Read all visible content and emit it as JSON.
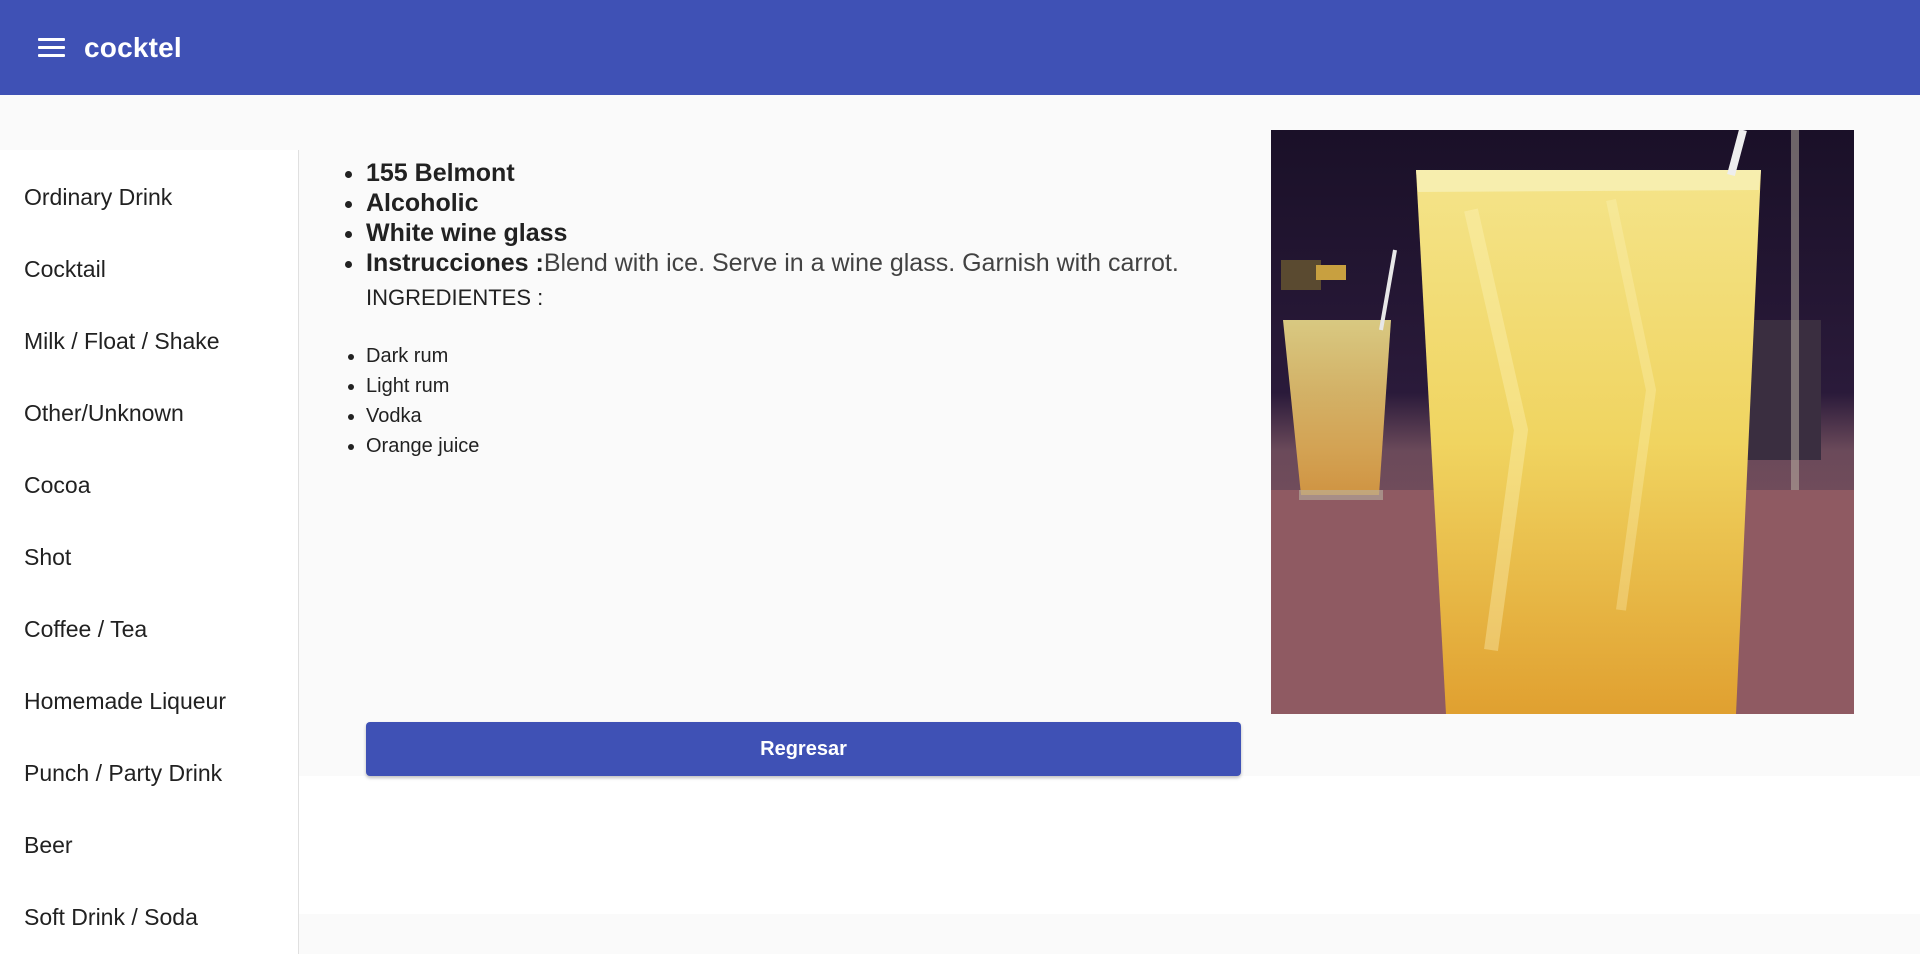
{
  "app": {
    "title": "cocktel"
  },
  "sidebar": {
    "items": [
      {
        "label": "Ordinary Drink"
      },
      {
        "label": "Cocktail"
      },
      {
        "label": "Milk / Float / Shake"
      },
      {
        "label": "Other/Unknown"
      },
      {
        "label": "Cocoa"
      },
      {
        "label": "Shot"
      },
      {
        "label": "Coffee / Tea"
      },
      {
        "label": "Homemade Liqueur"
      },
      {
        "label": "Punch / Party Drink"
      },
      {
        "label": "Beer"
      },
      {
        "label": "Soft Drink / Soda"
      }
    ]
  },
  "drink": {
    "name": "155 Belmont",
    "alcoholic": "Alcoholic",
    "glass": "White wine glass",
    "instructions_label": "Instrucciones :",
    "instructions": "Blend with ice. Serve in a wine glass. Garnish with carrot.",
    "ingredients_title": "INGREDIENTES :",
    "ingredients": [
      "Dark rum",
      "Light rum",
      "Vodka",
      "Orange juice"
    ]
  },
  "actions": {
    "back_label": "Regresar"
  },
  "colors": {
    "primary": "#3f51b5",
    "background": "#fafafa"
  },
  "icons": {
    "menu": "menu-icon"
  }
}
